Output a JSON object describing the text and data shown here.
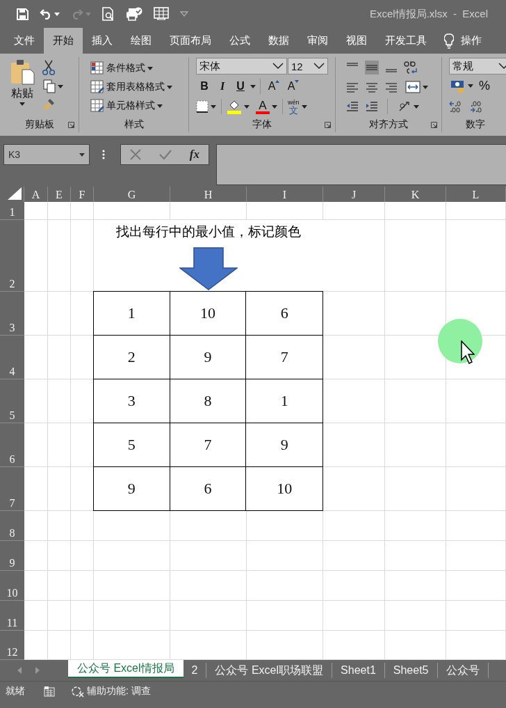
{
  "title": "Excel情报局.xlsx  -  Excel",
  "menu_tabs": [
    {
      "label": "文件",
      "selected": false
    },
    {
      "label": "开始",
      "selected": true
    },
    {
      "label": "插入",
      "selected": false
    },
    {
      "label": "绘图",
      "selected": false
    },
    {
      "label": "页面布局",
      "selected": false
    },
    {
      "label": "公式",
      "selected": false
    },
    {
      "label": "数据",
      "selected": false
    },
    {
      "label": "审阅",
      "selected": false
    },
    {
      "label": "视图",
      "selected": false
    },
    {
      "label": "开发工具",
      "selected": false
    }
  ],
  "tell_me": "操作",
  "ribbon": {
    "clipboard": {
      "label": "剪贴板",
      "paste": "粘贴"
    },
    "styles": {
      "label": "样式",
      "items": [
        "条件格式",
        "套用表格格式",
        "单元格样式"
      ]
    },
    "font": {
      "label": "字体",
      "font_name": "宋体",
      "font_size": "12",
      "style_buttons": [
        "B",
        "I",
        "U"
      ],
      "size_buttons": [
        "A",
        "A"
      ],
      "color_button": "A",
      "phonetic_top": "wén",
      "phonetic_bottom": "文"
    },
    "alignment": {
      "label": "对齐方式"
    },
    "number": {
      "label": "数字",
      "format": "常规",
      "percent": "%"
    }
  },
  "formula_bar": {
    "name_box": "K3",
    "fx": "fx"
  },
  "columns": [
    "A",
    "E",
    "F",
    "G",
    "H",
    "I",
    "J",
    "K",
    "L"
  ],
  "rows": [
    "1",
    "2",
    "3",
    "4",
    "5",
    "6",
    "7",
    "8",
    "9",
    "10",
    "11",
    "12"
  ],
  "note": "找出每行中的最小值，标记颜色",
  "table": [
    [
      "1",
      "10",
      "6"
    ],
    [
      "2",
      "9",
      "7"
    ],
    [
      "3",
      "8",
      "1"
    ],
    [
      "5",
      "7",
      "9"
    ],
    [
      "9",
      "6",
      "10"
    ]
  ],
  "sheet_tabs": [
    {
      "label": "公众号 Excel情报局",
      "selected": true
    },
    {
      "label": "2",
      "selected": false
    },
    {
      "label": "公众号 Excel职场联盟",
      "selected": false
    },
    {
      "label": "Sheet1",
      "selected": false
    },
    {
      "label": "Sheet5",
      "selected": false
    },
    {
      "label": "公众号",
      "selected": false
    }
  ],
  "status_bar": {
    "mode": "就绪",
    "accessibility": "辅助功能: 调查"
  }
}
